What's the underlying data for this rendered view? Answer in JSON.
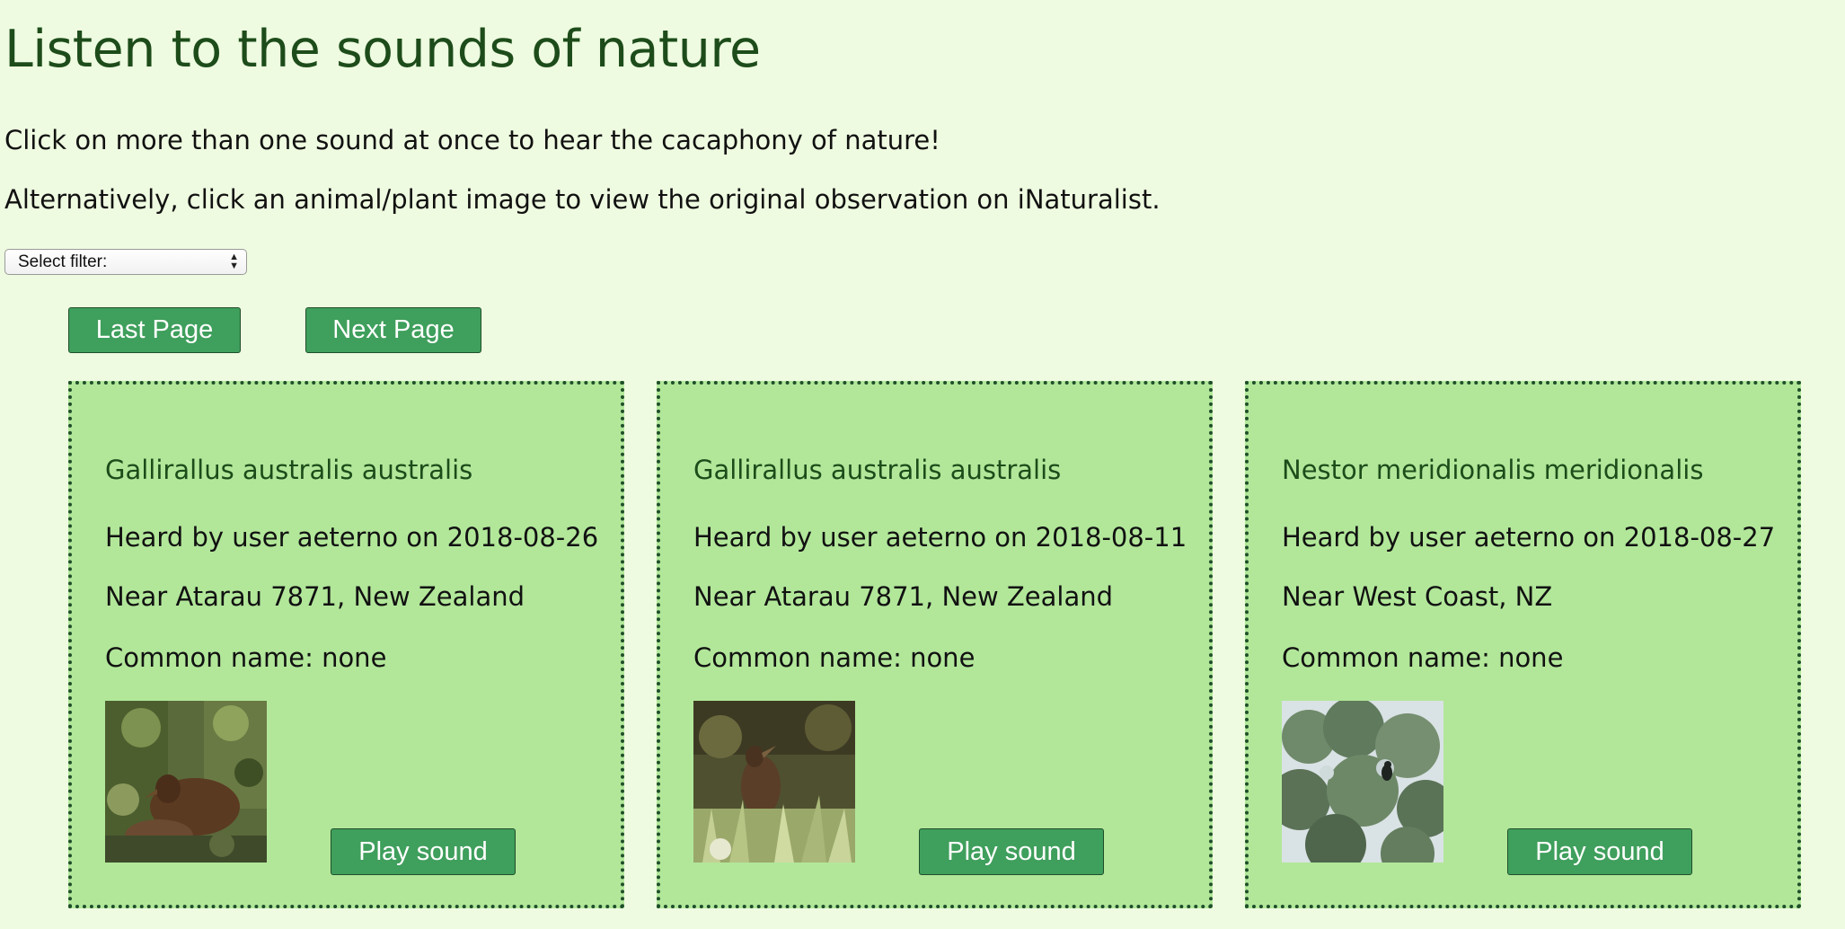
{
  "header": {
    "title": "Listen to the sounds of nature",
    "intro_1": "Click on more than one sound at once to hear the cacaphony of nature!",
    "intro_2": "Alternatively, click an animal/plant image to view the original observation on iNaturalist."
  },
  "filter": {
    "selected": "Select filter:"
  },
  "pagination": {
    "last_label": "Last Page",
    "next_label": "Next Page"
  },
  "cards": [
    {
      "species": "Gallirallus australis australis",
      "heard": "Heard by user aeterno on 2018-08-26",
      "place": "Near Atarau 7871, New Zealand",
      "common": "Common name: none",
      "play_label": "Play sound",
      "image_icon": "weka-bird-photo"
    },
    {
      "species": "Gallirallus australis australis",
      "heard": "Heard by user aeterno on 2018-08-11",
      "place": "Near Atarau 7871, New Zealand",
      "common": "Common name: none",
      "play_label": "Play sound",
      "image_icon": "weka-bird-photo"
    },
    {
      "species": "Nestor meridionalis meridionalis",
      "heard": "Heard by user aeterno on 2018-08-27",
      "place": "Near West Coast, NZ",
      "common": "Common name: none",
      "play_label": "Play sound",
      "image_icon": "kaka-tree-photo"
    }
  ],
  "colors": {
    "page_background": "#eefbe0",
    "card_background": "#b2e79a",
    "button_background": "#3f9f5c",
    "title_text": "#1d4c1a",
    "border": "#1f4f2a"
  }
}
